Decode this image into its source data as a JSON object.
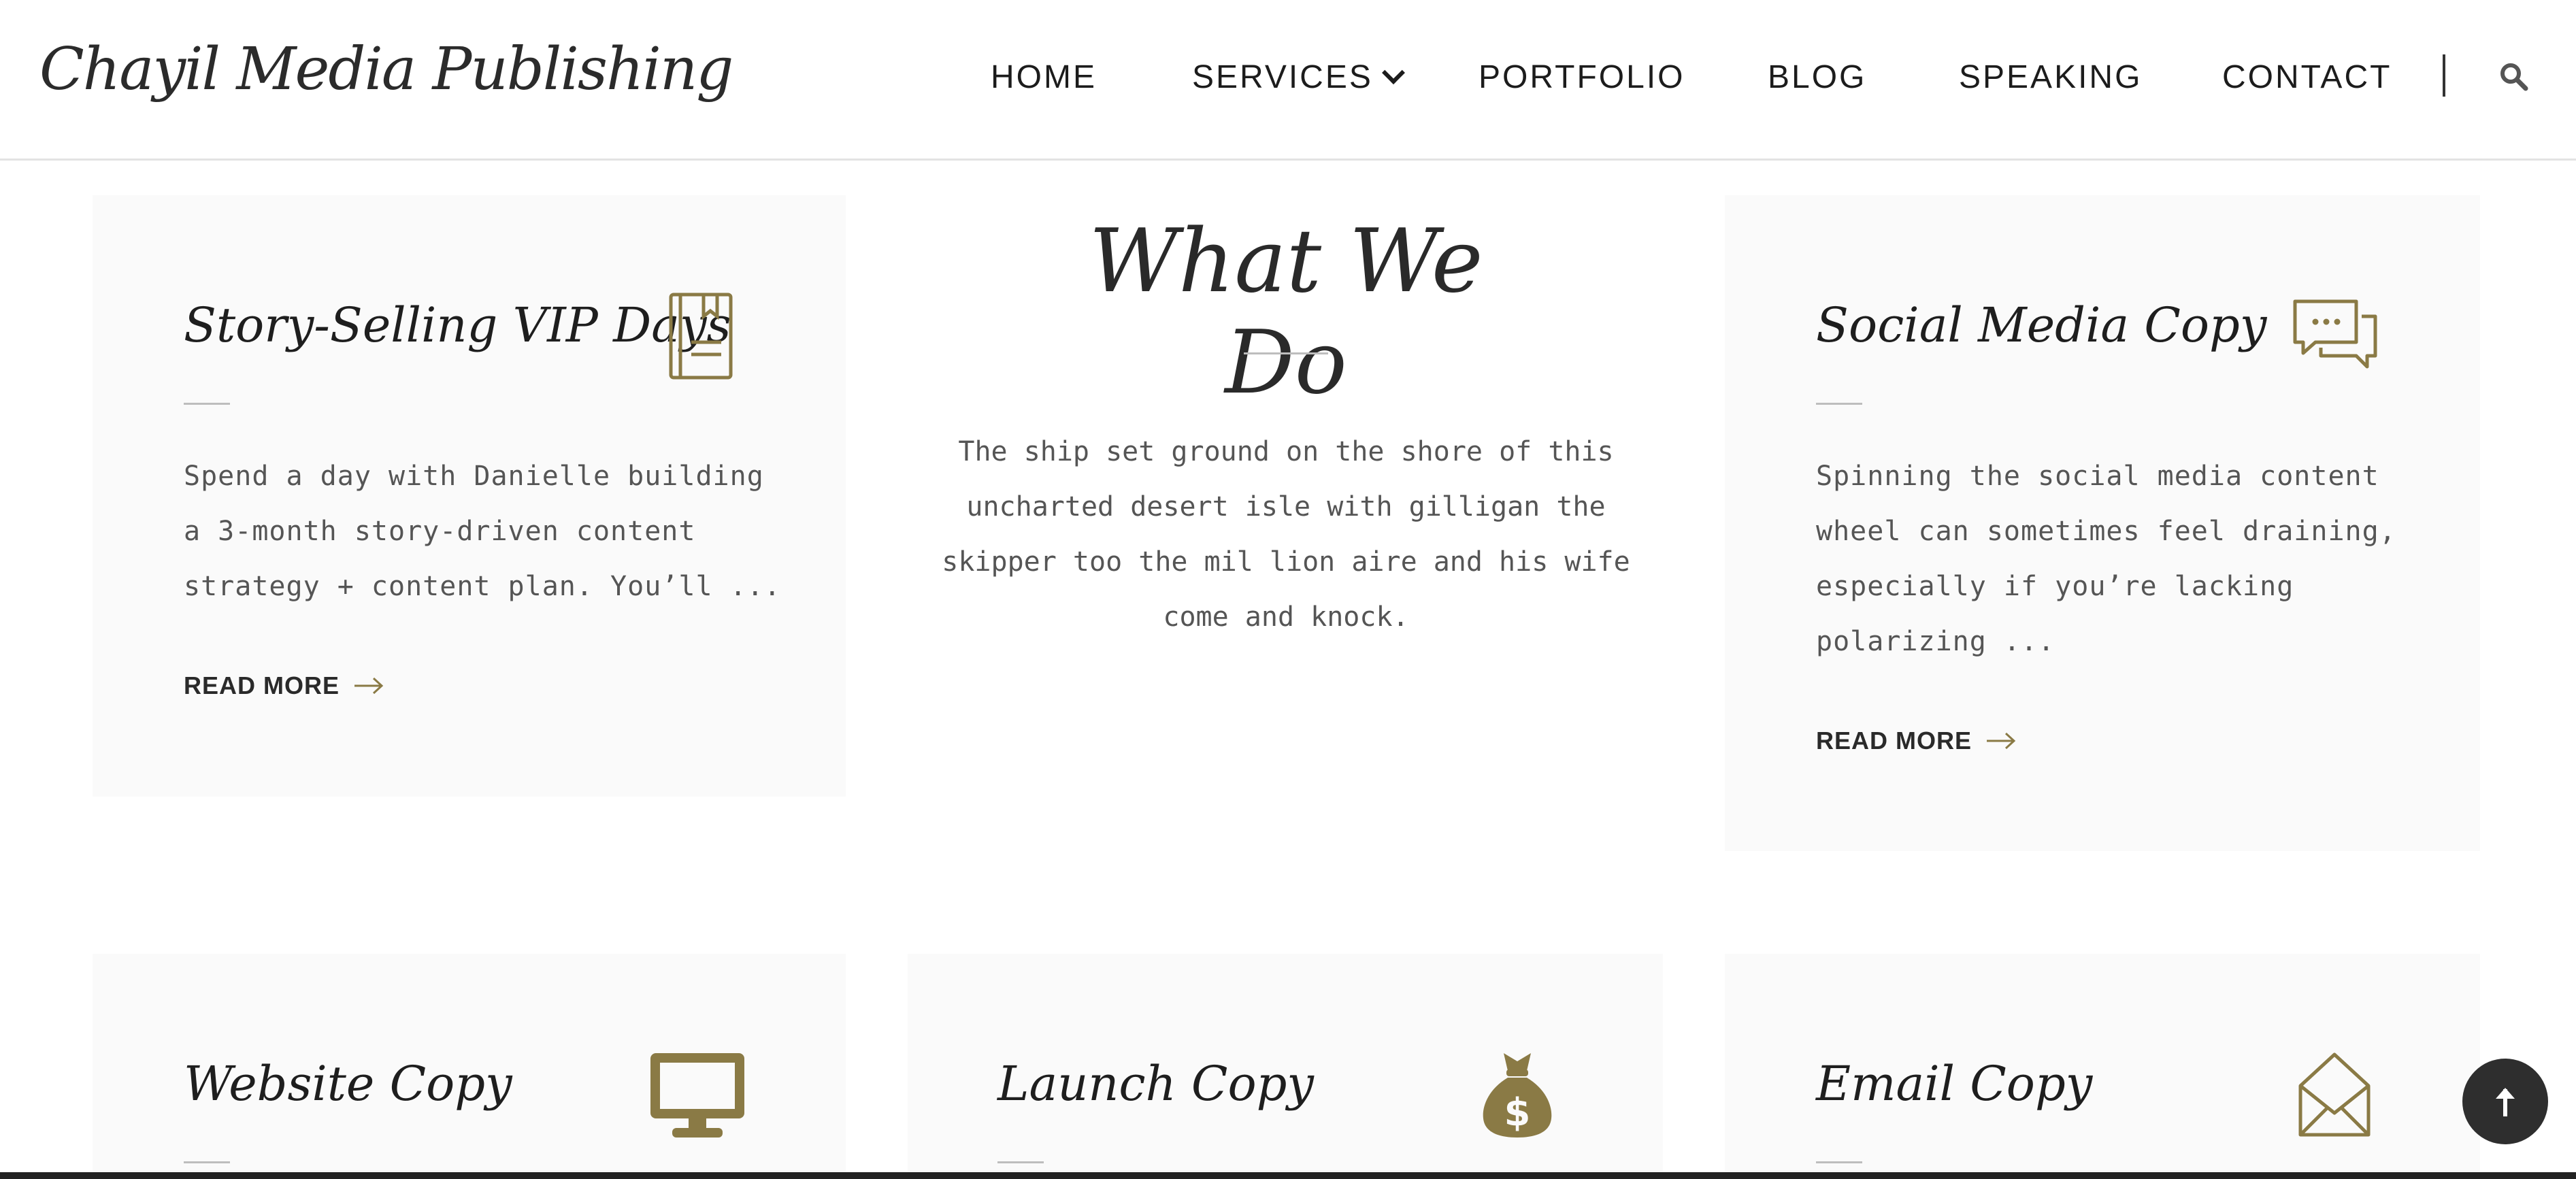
{
  "header": {
    "logo_text": "Chayil Media Publishing",
    "nav": [
      {
        "label": "HOME"
      },
      {
        "label": "SERVICES"
      },
      {
        "label": "PORTFOLIO"
      },
      {
        "label": "BLOG"
      },
      {
        "label": "SPEAKING"
      },
      {
        "label": "CONTACT"
      }
    ],
    "search_icon": "search-icon"
  },
  "section": {
    "title": "What We Do",
    "text": "The ship set ground on the shore of this uncharted desert isle with gilligan the skipper too the mil lion aire and his wife come and knock."
  },
  "cards": [
    {
      "title": "Story-Selling VIP Days",
      "icon": "book-icon",
      "text": "Spend a day with Danielle building a 3-month story-driven content strategy + content plan. You’ll ...",
      "read_more": "READ MORE"
    },
    {
      "title": "Social Media Copy",
      "icon": "chat-bubbles-icon",
      "text": "Spinning the social media content wheel can sometimes feel draining, especially if you’re lacking polarizing ...",
      "read_more": "READ MORE"
    },
    {
      "title": "Website Copy",
      "icon": "monitor-icon"
    },
    {
      "title": "Launch Copy",
      "icon": "money-bag-icon"
    },
    {
      "title": "Email Copy",
      "icon": "envelope-icon"
    }
  ],
  "scroll_top_icon": "arrow-up-icon",
  "colors": {
    "accent": "#8a7a45",
    "card_bg": "#fafafa",
    "text": "#555555",
    "heading": "#1e1e1e"
  }
}
